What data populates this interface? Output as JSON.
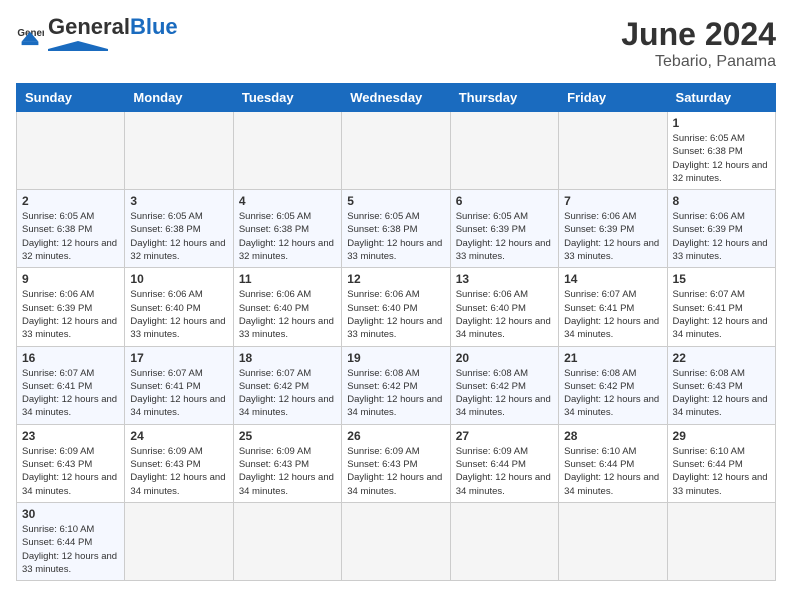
{
  "header": {
    "logo_general": "General",
    "logo_blue": "Blue",
    "month_title": "June 2024",
    "location": "Tebario, Panama"
  },
  "days_of_week": [
    "Sunday",
    "Monday",
    "Tuesday",
    "Wednesday",
    "Thursday",
    "Friday",
    "Saturday"
  ],
  "weeks": [
    [
      {
        "day": "",
        "empty": true
      },
      {
        "day": "",
        "empty": true
      },
      {
        "day": "",
        "empty": true
      },
      {
        "day": "",
        "empty": true
      },
      {
        "day": "",
        "empty": true
      },
      {
        "day": "",
        "empty": true
      },
      {
        "day": "1",
        "sunrise": "6:05 AM",
        "sunset": "6:38 PM",
        "daylight": "12 hours and 32 minutes."
      }
    ],
    [
      {
        "day": "2",
        "sunrise": "6:05 AM",
        "sunset": "6:38 PM",
        "daylight": "12 hours and 32 minutes."
      },
      {
        "day": "3",
        "sunrise": "6:05 AM",
        "sunset": "6:38 PM",
        "daylight": "12 hours and 32 minutes."
      },
      {
        "day": "4",
        "sunrise": "6:05 AM",
        "sunset": "6:38 PM",
        "daylight": "12 hours and 32 minutes."
      },
      {
        "day": "5",
        "sunrise": "6:05 AM",
        "sunset": "6:38 PM",
        "daylight": "12 hours and 33 minutes."
      },
      {
        "day": "6",
        "sunrise": "6:05 AM",
        "sunset": "6:39 PM",
        "daylight": "12 hours and 33 minutes."
      },
      {
        "day": "7",
        "sunrise": "6:06 AM",
        "sunset": "6:39 PM",
        "daylight": "12 hours and 33 minutes."
      },
      {
        "day": "8",
        "sunrise": "6:06 AM",
        "sunset": "6:39 PM",
        "daylight": "12 hours and 33 minutes."
      }
    ],
    [
      {
        "day": "9",
        "sunrise": "6:06 AM",
        "sunset": "6:39 PM",
        "daylight": "12 hours and 33 minutes."
      },
      {
        "day": "10",
        "sunrise": "6:06 AM",
        "sunset": "6:40 PM",
        "daylight": "12 hours and 33 minutes."
      },
      {
        "day": "11",
        "sunrise": "6:06 AM",
        "sunset": "6:40 PM",
        "daylight": "12 hours and 33 minutes."
      },
      {
        "day": "12",
        "sunrise": "6:06 AM",
        "sunset": "6:40 PM",
        "daylight": "12 hours and 33 minutes."
      },
      {
        "day": "13",
        "sunrise": "6:06 AM",
        "sunset": "6:40 PM",
        "daylight": "12 hours and 34 minutes."
      },
      {
        "day": "14",
        "sunrise": "6:07 AM",
        "sunset": "6:41 PM",
        "daylight": "12 hours and 34 minutes."
      },
      {
        "day": "15",
        "sunrise": "6:07 AM",
        "sunset": "6:41 PM",
        "daylight": "12 hours and 34 minutes."
      }
    ],
    [
      {
        "day": "16",
        "sunrise": "6:07 AM",
        "sunset": "6:41 PM",
        "daylight": "12 hours and 34 minutes."
      },
      {
        "day": "17",
        "sunrise": "6:07 AM",
        "sunset": "6:41 PM",
        "daylight": "12 hours and 34 minutes."
      },
      {
        "day": "18",
        "sunrise": "6:07 AM",
        "sunset": "6:42 PM",
        "daylight": "12 hours and 34 minutes."
      },
      {
        "day": "19",
        "sunrise": "6:08 AM",
        "sunset": "6:42 PM",
        "daylight": "12 hours and 34 minutes."
      },
      {
        "day": "20",
        "sunrise": "6:08 AM",
        "sunset": "6:42 PM",
        "daylight": "12 hours and 34 minutes."
      },
      {
        "day": "21",
        "sunrise": "6:08 AM",
        "sunset": "6:42 PM",
        "daylight": "12 hours and 34 minutes."
      },
      {
        "day": "22",
        "sunrise": "6:08 AM",
        "sunset": "6:43 PM",
        "daylight": "12 hours and 34 minutes."
      }
    ],
    [
      {
        "day": "23",
        "sunrise": "6:09 AM",
        "sunset": "6:43 PM",
        "daylight": "12 hours and 34 minutes."
      },
      {
        "day": "24",
        "sunrise": "6:09 AM",
        "sunset": "6:43 PM",
        "daylight": "12 hours and 34 minutes."
      },
      {
        "day": "25",
        "sunrise": "6:09 AM",
        "sunset": "6:43 PM",
        "daylight": "12 hours and 34 minutes."
      },
      {
        "day": "26",
        "sunrise": "6:09 AM",
        "sunset": "6:43 PM",
        "daylight": "12 hours and 34 minutes."
      },
      {
        "day": "27",
        "sunrise": "6:09 AM",
        "sunset": "6:44 PM",
        "daylight": "12 hours and 34 minutes."
      },
      {
        "day": "28",
        "sunrise": "6:10 AM",
        "sunset": "6:44 PM",
        "daylight": "12 hours and 34 minutes."
      },
      {
        "day": "29",
        "sunrise": "6:10 AM",
        "sunset": "6:44 PM",
        "daylight": "12 hours and 33 minutes."
      }
    ],
    [
      {
        "day": "30",
        "sunrise": "6:10 AM",
        "sunset": "6:44 PM",
        "daylight": "12 hours and 33 minutes."
      },
      {
        "day": "",
        "empty": true
      },
      {
        "day": "",
        "empty": true
      },
      {
        "day": "",
        "empty": true
      },
      {
        "day": "",
        "empty": true
      },
      {
        "day": "",
        "empty": true
      },
      {
        "day": "",
        "empty": true
      }
    ]
  ]
}
